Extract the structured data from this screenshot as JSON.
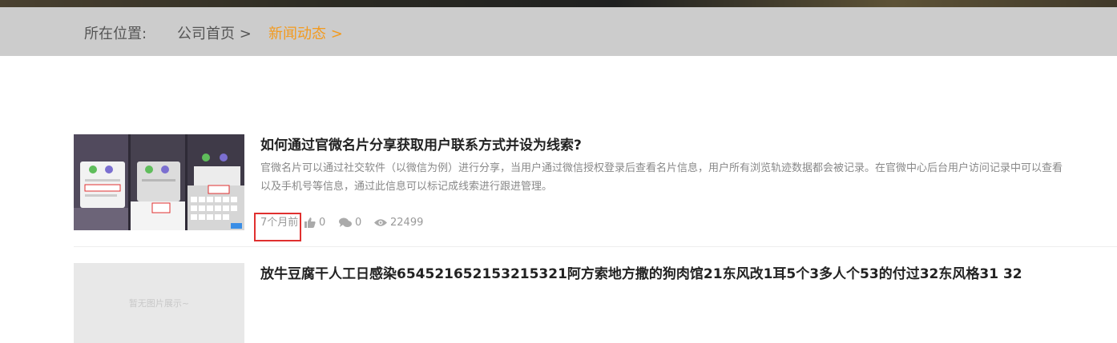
{
  "breadcrumb": {
    "prefix": "所在位置:",
    "home": "公司首页 >",
    "current": "新闻动态 >"
  },
  "articles": [
    {
      "title": "如何通过官微名片分享获取用户联系方式并设为线索?",
      "summary_line1": "官微名片可以通过社交软件（以微信为例）进行分享，当用户通过微信授权登录后查看名片信息，用户所有浏览轨迹数据都会被记录。在官微中心后台用户访问记录中可以查看",
      "summary_line2": "以及手机号等信息，通过此信息可以标记成线索进行跟进管理。",
      "time": "7个月前",
      "likes": "0",
      "comments": "0",
      "views": "22499"
    },
    {
      "title": "放牛豆腐干人工日感染654521652153215321阿方索地方撒的狗肉馆21东风改1耳5个3多人个53的付过32东风格31 32",
      "placeholder": "暂无图片展示~"
    }
  ]
}
